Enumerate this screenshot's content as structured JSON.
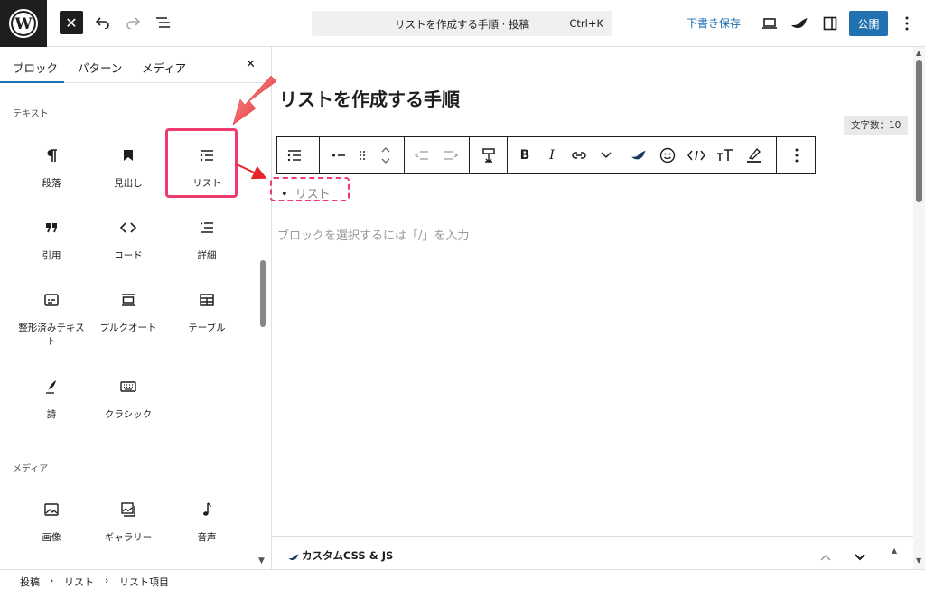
{
  "topbar": {
    "logo": "wordpress-logo",
    "close_label": "✕",
    "command": {
      "title": "リストを作成する手順 · 投稿",
      "shortcut": "Ctrl+K"
    },
    "draft_label": "下書き保存",
    "publish_label": "公開"
  },
  "sidebar": {
    "tabs": [
      {
        "label": "ブロック",
        "active": true
      },
      {
        "label": "パターン"
      },
      {
        "label": "メディア"
      }
    ],
    "close_label": "✕",
    "sections": {
      "text": "テキスト",
      "media": "メディア"
    },
    "text_blocks": [
      {
        "label": "段落",
        "icon": "paragraph-icon"
      },
      {
        "label": "見出し",
        "icon": "bookmark-icon"
      },
      {
        "label": "リスト",
        "icon": "list-icon",
        "highlighted": true
      },
      {
        "label": "引用",
        "icon": "quote-icon"
      },
      {
        "label": "コード",
        "icon": "code-icon"
      },
      {
        "label": "詳細",
        "icon": "details-icon"
      },
      {
        "label": "整形済みテキスト",
        "icon": "preformatted-icon"
      },
      {
        "label": "プルクオート",
        "icon": "pullquote-icon"
      },
      {
        "label": "テーブル",
        "icon": "table-icon"
      },
      {
        "label": "詩",
        "icon": "verse-icon"
      },
      {
        "label": "クラシック",
        "icon": "keyboard-icon"
      }
    ],
    "media_blocks": [
      {
        "label": "画像",
        "icon": "image-icon"
      },
      {
        "label": "ギャラリー",
        "icon": "gallery-icon"
      },
      {
        "label": "音声",
        "icon": "audio-icon"
      }
    ]
  },
  "editor": {
    "title": "リストを作成する手順",
    "word_count": "文字数：10",
    "list_item": "リスト",
    "placeholder": "ブロックを選択するには「/」を入力"
  },
  "panel": {
    "title": "カスタムCSS & JS"
  },
  "breadcrumb": [
    "投稿",
    "リスト",
    "リスト項目"
  ],
  "colors": {
    "accent": "#2271b1",
    "highlight": "#ee3a6e",
    "dark": "#1e1e1e"
  }
}
